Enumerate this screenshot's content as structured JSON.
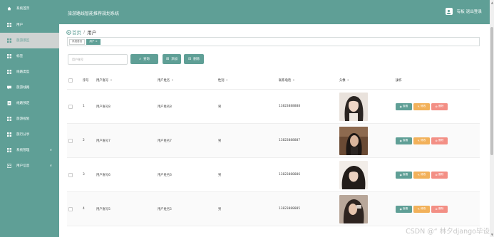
{
  "sidebar": {
    "items": [
      {
        "label": "系统首页",
        "icon": "home-icon"
      },
      {
        "label": "用户",
        "icon": "grid-icon"
      },
      {
        "label": "旅游景区",
        "icon": "grid-icon"
      },
      {
        "label": "标签",
        "icon": "grid-icon"
      },
      {
        "label": "线路类型",
        "icon": "grid-icon"
      },
      {
        "label": "旅游线路",
        "icon": "message-icon"
      },
      {
        "label": "线路预定",
        "icon": "document-icon"
      },
      {
        "label": "旅游规划",
        "icon": "grid-icon"
      },
      {
        "label": "旅行分享",
        "icon": "grid-icon"
      },
      {
        "label": "系统管理",
        "icon": "grid-icon",
        "chevron": "∨"
      },
      {
        "label": "用户信息",
        "icon": "user-card-icon",
        "chevron": "∨"
      }
    ],
    "active_index": 2
  },
  "header": {
    "title": "旅游路线智能推荐规划系统",
    "user_text": "有板 退出登录"
  },
  "breadcrumb": {
    "home": "首页",
    "separator": "/",
    "current": "用户"
  },
  "tags": [
    {
      "label": "系统首页"
    },
    {
      "label": "用户 ×"
    }
  ],
  "toolbar": {
    "search_placeholder": "用户账号",
    "search_label": "查询",
    "add_label": "添加",
    "delete_label": "删除"
  },
  "table": {
    "columns": [
      "序号",
      "用户账号",
      "用户姓名",
      "性别",
      "联系电话",
      "头像",
      "操作"
    ],
    "rows": [
      {
        "index": "1",
        "account": "用户账号8",
        "name": "用户姓名8",
        "sex": "男",
        "phone": "13823888888"
      },
      {
        "index": "2",
        "account": "用户账号7",
        "name": "用户姓名7",
        "sex": "男",
        "phone": "13823888887"
      },
      {
        "index": "3",
        "account": "用户账号6",
        "name": "用户姓名6",
        "sex": "男",
        "phone": "13823888886"
      },
      {
        "index": "4",
        "account": "用户账号5",
        "name": "用户姓名5",
        "sex": "男",
        "phone": "13823888885"
      }
    ],
    "ops": {
      "view": "查看",
      "edit": "修改",
      "delete": "删除"
    }
  },
  "watermark": "CSDN @“ 林夕django毕设",
  "colors": {
    "primary": "#5f9f96",
    "edit": "#f2b15a",
    "delete": "#f38f85"
  }
}
